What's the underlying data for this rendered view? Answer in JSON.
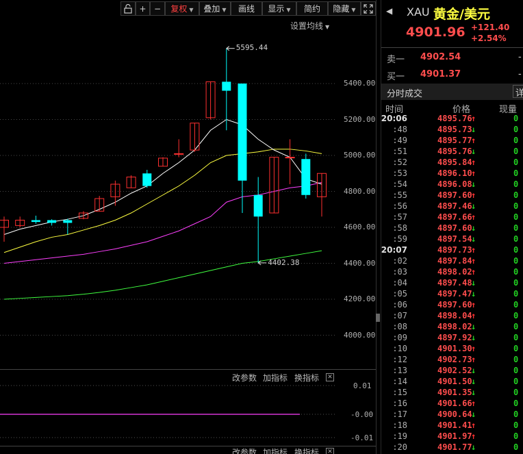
{
  "toolbar": {
    "fuquan": "复权",
    "diejia": "叠加",
    "huaxian": "画线",
    "xianshi": "显示",
    "jianyue": "简约",
    "yincang": "隐藏"
  },
  "chart": {
    "setup_label": "设置均线",
    "price_axis": [
      "5400.00",
      "5200.00",
      "5000.00",
      "4800.00",
      "4600.00",
      "4400.00",
      "4200.00",
      "4000.00"
    ],
    "high_marker": "5595.44",
    "low_marker": "4402.38",
    "pane1": {
      "change_params": "改参数",
      "add_indicator": "加指标",
      "swap_indicator": "换指标",
      "axis": [
        "0.01",
        "-0.00",
        "-0.01"
      ]
    },
    "pane2": {
      "change_params": "改参数",
      "add_indicator": "加指标",
      "swap_indicator": "换指标"
    },
    "colors": {
      "up": "#ff3030",
      "down": "#00ffff",
      "ma5": "#ffffff",
      "ma10": "#ffff40",
      "ma20": "#ff40ff",
      "ma60": "#40ff40"
    }
  },
  "chart_data": {
    "type": "candlestick",
    "ylim": [
      3940,
      5650
    ],
    "candles": [
      {
        "o": 4600,
        "h": 4660,
        "l": 4520,
        "c": 4640
      },
      {
        "o": 4610,
        "h": 4660,
        "l": 4600,
        "c": 4640
      },
      {
        "o": 4640,
        "h": 4665,
        "l": 4620,
        "c": 4630
      },
      {
        "o": 4640,
        "h": 4645,
        "l": 4610,
        "c": 4625
      },
      {
        "o": 4640,
        "h": 4648,
        "l": 4560,
        "c": 4625
      },
      {
        "o": 4650,
        "h": 4690,
        "l": 4645,
        "c": 4680
      },
      {
        "o": 4690,
        "h": 4775,
        "l": 4690,
        "c": 4760
      },
      {
        "o": 4770,
        "h": 4860,
        "l": 4720,
        "c": 4840
      },
      {
        "o": 4820,
        "h": 4890,
        "l": 4820,
        "c": 4880
      },
      {
        "o": 4900,
        "h": 4920,
        "l": 4820,
        "c": 4830
      },
      {
        "o": 4940,
        "h": 4990,
        "l": 4940,
        "c": 4985
      },
      {
        "o": 5010,
        "h": 5090,
        "l": 4990,
        "c": 5010
      },
      {
        "o": 5030,
        "h": 5180,
        "l": 5020,
        "c": 5180
      },
      {
        "o": 5210,
        "h": 5410,
        "l": 5200,
        "c": 5410
      },
      {
        "o": 5410,
        "h": 5595.44,
        "l": 5140,
        "c": 5360
      },
      {
        "o": 5400,
        "h": 5400,
        "l": 4680,
        "c": 4860
      },
      {
        "o": 4780,
        "h": 4880,
        "l": 4402.38,
        "c": 4660
      },
      {
        "o": 4680,
        "h": 4990,
        "l": 4680,
        "c": 4990
      },
      {
        "o": 4990,
        "h": 5090,
        "l": 4840,
        "c": 4990
      },
      {
        "o": 4980,
        "h": 5010,
        "l": 4760,
        "c": 4780
      },
      {
        "o": 4770,
        "h": 4900,
        "l": 4660,
        "c": 4900
      }
    ],
    "ma5": [
      4560,
      4590,
      4610,
      4630,
      4645,
      4665,
      4700,
      4740,
      4790,
      4830,
      4900,
      4960,
      5030,
      5140,
      5200,
      5170,
      5090,
      5030,
      4990,
      4870,
      4840
    ],
    "ma10": [
      4460,
      4490,
      4520,
      4545,
      4560,
      4585,
      4610,
      4640,
      4680,
      4730,
      4780,
      4830,
      4890,
      4960,
      5000,
      5010,
      5020,
      5035,
      5035,
      5025,
      5010
    ],
    "ma20": [
      4400,
      4410,
      4420,
      4430,
      4440,
      4450,
      4465,
      4480,
      4500,
      4520,
      4550,
      4580,
      4620,
      4660,
      4740,
      4770,
      4780,
      4800,
      4820,
      4830,
      4850
    ],
    "ma60": [
      4200,
      4205,
      4210,
      4215,
      4220,
      4228,
      4238,
      4250,
      4265,
      4280,
      4300,
      4320,
      4340,
      4360,
      4380,
      4400,
      4410,
      4425,
      4440,
      4455,
      4470
    ]
  },
  "right": {
    "symbol": "XAU",
    "name": "黄金/美元",
    "price": "4901.96",
    "change": "+121.40",
    "change_pct": "+2.54%",
    "sell_label": "卖一",
    "sell_price": "4902.54",
    "sell_dash": "-",
    "buy_label": "买一",
    "buy_price": "4901.37",
    "buy_dash": "-",
    "section_title": "分时成交",
    "detail": "详",
    "col_time": "时间",
    "col_price": "价格",
    "col_vol": "现量",
    "ticks": [
      {
        "t": "20:06",
        "p": "4895.76",
        "d": "↑",
        "v": "0",
        "full": true
      },
      {
        "t": ":48",
        "p": "4895.73",
        "d": "↓",
        "v": "0"
      },
      {
        "t": ":49",
        "p": "4895.77",
        "d": "↑",
        "v": "0"
      },
      {
        "t": ":51",
        "p": "4895.76",
        "d": "↓",
        "v": "0"
      },
      {
        "t": ":52",
        "p": "4895.84",
        "d": "↑",
        "v": "0"
      },
      {
        "t": ":53",
        "p": "4896.10",
        "d": "↑",
        "v": "0"
      },
      {
        "t": ":54",
        "p": "4896.08",
        "d": "↓",
        "v": "0"
      },
      {
        "t": ":55",
        "p": "4897.60",
        "d": "↑",
        "v": "0"
      },
      {
        "t": ":56",
        "p": "4897.46",
        "d": "↓",
        "v": "0"
      },
      {
        "t": ":57",
        "p": "4897.66",
        "d": "↑",
        "v": "0"
      },
      {
        "t": ":58",
        "p": "4897.60",
        "d": "↓",
        "v": "0"
      },
      {
        "t": ":59",
        "p": "4897.54",
        "d": "↓",
        "v": "0"
      },
      {
        "t": "20:07",
        "p": "4897.73",
        "d": "↑",
        "v": "0",
        "full": true
      },
      {
        "t": ":02",
        "p": "4897.84",
        "d": "↑",
        "v": "0"
      },
      {
        "t": ":03",
        "p": "4898.02",
        "d": "↑",
        "v": "0"
      },
      {
        "t": ":04",
        "p": "4897.48",
        "d": "↓",
        "v": "0"
      },
      {
        "t": ":05",
        "p": "4897.47",
        "d": "↓",
        "v": "0"
      },
      {
        "t": ":06",
        "p": "4897.60",
        "d": "↑",
        "v": "0"
      },
      {
        "t": ":07",
        "p": "4898.04",
        "d": "↑",
        "v": "0"
      },
      {
        "t": ":08",
        "p": "4898.02",
        "d": "↓",
        "v": "0"
      },
      {
        "t": ":09",
        "p": "4897.92",
        "d": "↓",
        "v": "0"
      },
      {
        "t": ":10",
        "p": "4901.30",
        "d": "↑",
        "v": "0"
      },
      {
        "t": ":12",
        "p": "4902.73",
        "d": "↑",
        "v": "0"
      },
      {
        "t": ":13",
        "p": "4902.52",
        "d": "↓",
        "v": "0"
      },
      {
        "t": ":14",
        "p": "4901.50",
        "d": "↓",
        "v": "0"
      },
      {
        "t": ":15",
        "p": "4901.35",
        "d": "↓",
        "v": "0"
      },
      {
        "t": ":16",
        "p": "4901.66",
        "d": "↑",
        "v": "0"
      },
      {
        "t": ":17",
        "p": "4900.64",
        "d": "↓",
        "v": "0"
      },
      {
        "t": ":18",
        "p": "4901.41",
        "d": "↑",
        "v": "0"
      },
      {
        "t": ":19",
        "p": "4901.97",
        "d": "↑",
        "v": "0"
      },
      {
        "t": ":20",
        "p": "4901.77",
        "d": "↓",
        "v": "0"
      }
    ]
  }
}
